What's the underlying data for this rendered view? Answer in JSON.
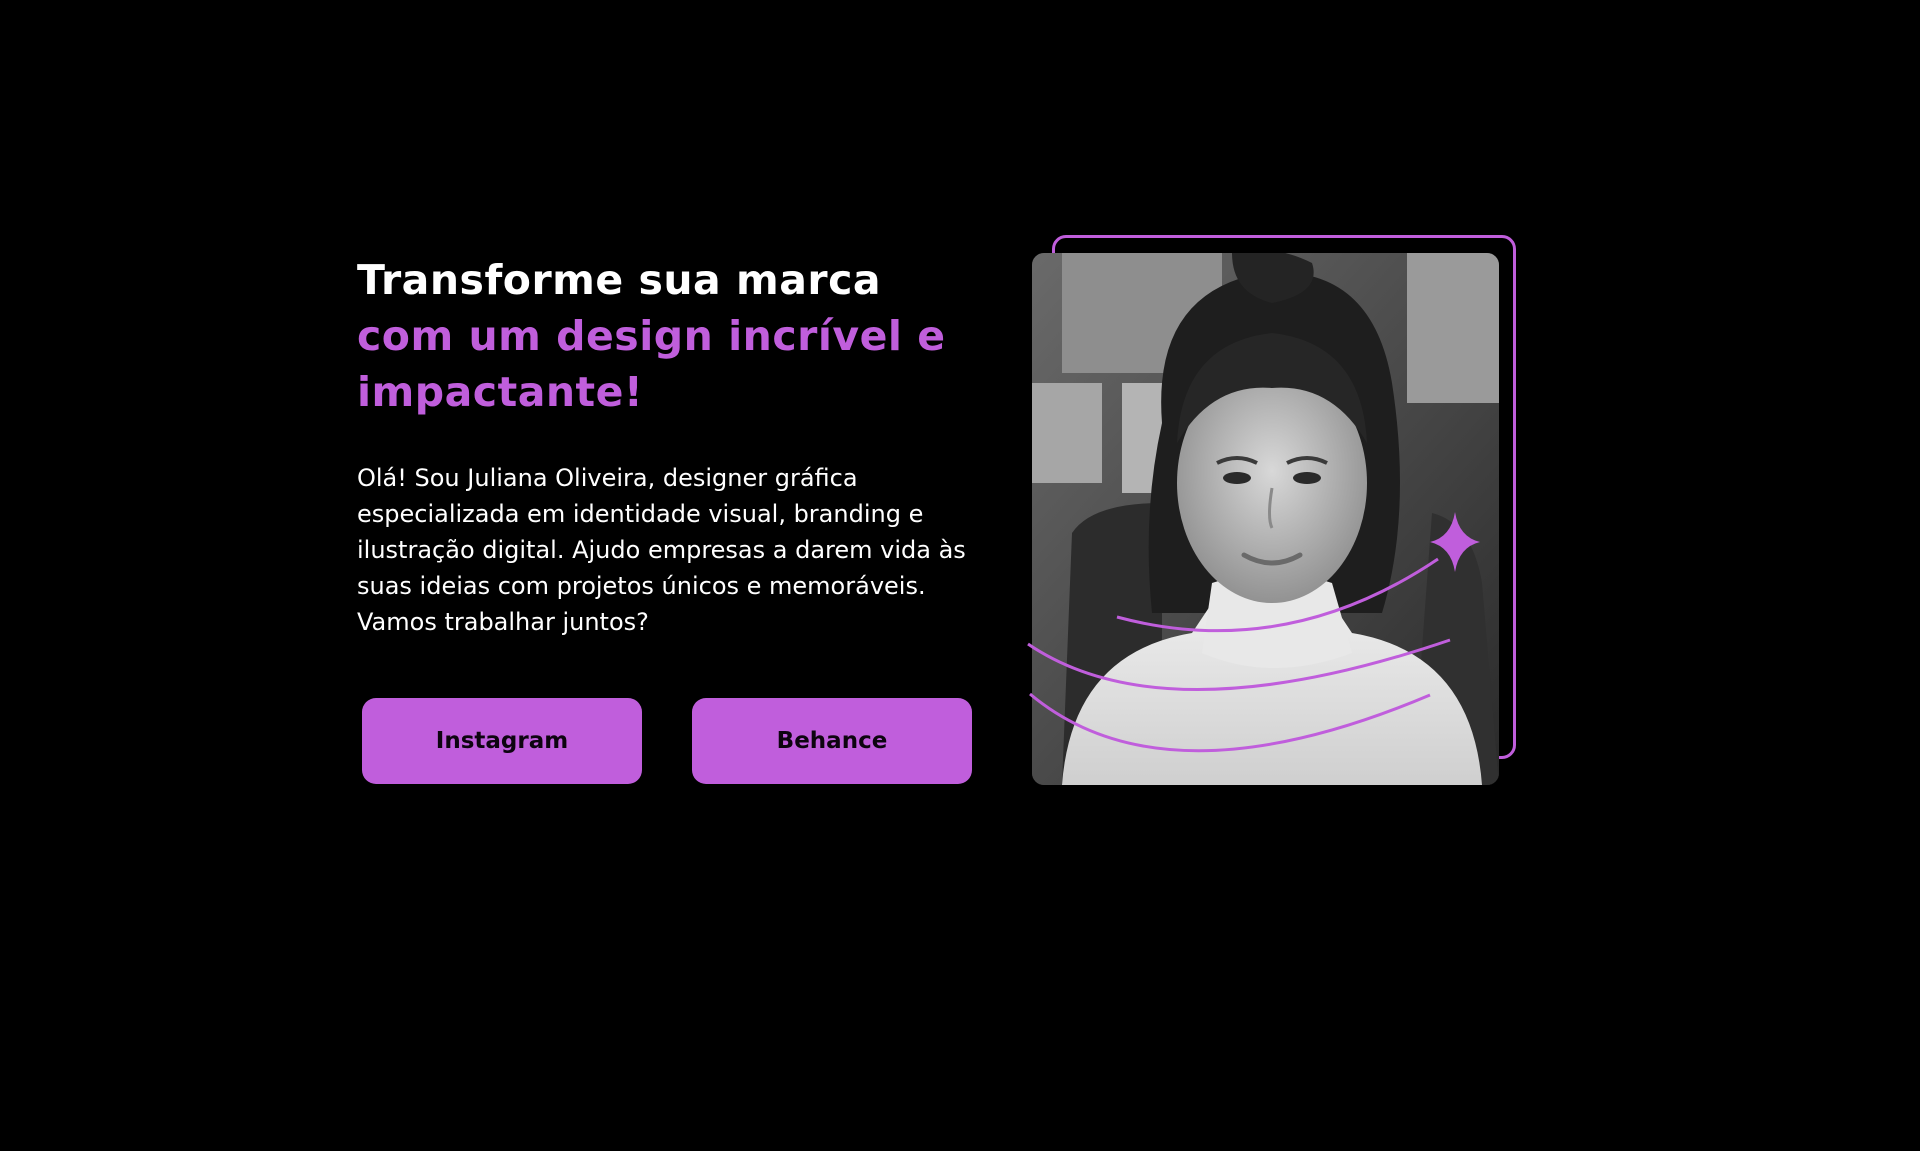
{
  "hero": {
    "headline_line1": "Transforme sua marca",
    "headline_line2": "com um design incrível e",
    "headline_line3": "impactante!",
    "intro": "Olá! Sou Juliana Oliveira, designer gráfica especializada em identidade visual, branding e ilustração digital. Ajudo empresas a darem vida às suas ideias com projetos únicos e memoráveis. Vamos trabalhar juntos?"
  },
  "buttons": {
    "instagram_label": "Instagram",
    "behance_label": "Behance"
  },
  "colors": {
    "background": "#000000",
    "accent": "#c05edc",
    "text": "#ffffff",
    "button_text": "#0d0410"
  },
  "icons": {
    "sparkle": "sparkle-icon"
  }
}
